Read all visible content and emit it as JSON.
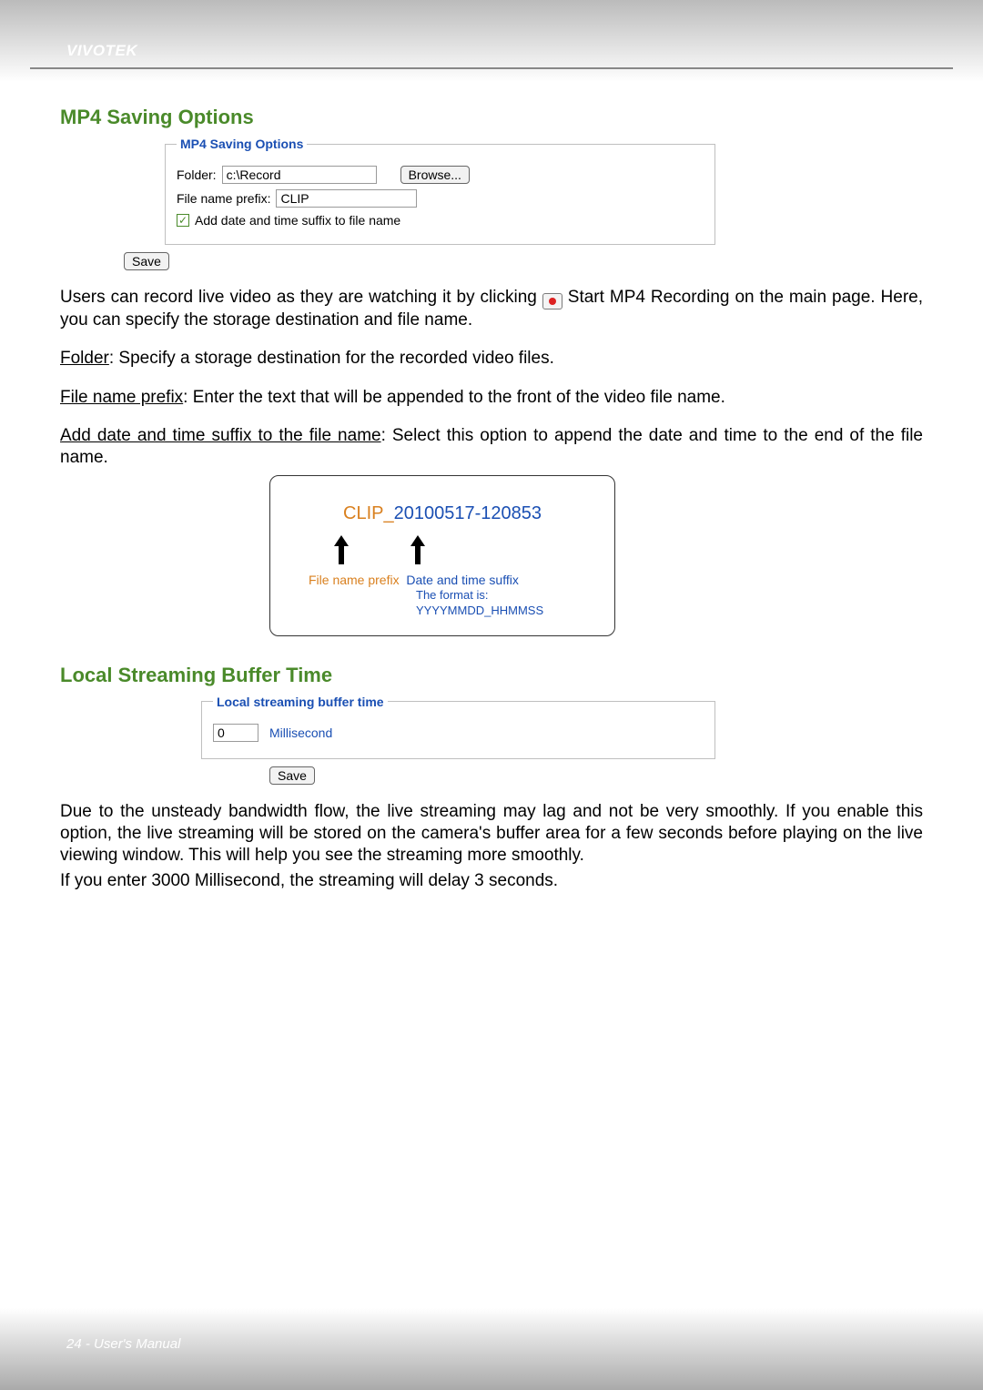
{
  "header": {
    "brand": "VIVOTEK"
  },
  "section1": {
    "title": "MP4 Saving Options",
    "shot": {
      "legend": "MP4 Saving Options",
      "folder_label": "Folder:",
      "folder_value": "c:\\Record",
      "browse_label": "Browse...",
      "prefix_label": "File name prefix:",
      "prefix_value": "CLIP",
      "suffix_checked": true,
      "suffix_label": "Add date and time suffix to file name",
      "save_label": "Save"
    },
    "para1_a": "Users can record live video as they are watching it by clicking ",
    "para1_b": " Start MP4 Recording on the main page. Here, you can specify the storage destination and file name.",
    "para2_u": "Folder",
    "para2_rest": ": Specify a storage destination for the recorded video files.",
    "para3_u": "File name prefix",
    "para3_rest": ": Enter the text that will be appended to the front of the video file name.",
    "para4_u": "Add date and time suffix to the file name",
    "para4_rest": ": Select this option to append the date and time to the end of the file name.",
    "example": {
      "prefix": "CLIP_",
      "suffix": "20100517-120853",
      "label_prefix": "File name prefix",
      "label_suffix": "Date and time suffix",
      "format_line": "The format is: YYYYMMDD_HHMMSS"
    }
  },
  "section2": {
    "title": "Local Streaming Buffer Time",
    "shot": {
      "legend": "Local streaming buffer time",
      "value": "0",
      "unit": "Millisecond",
      "save_label": "Save"
    },
    "para": "Due to the unsteady bandwidth flow, the live streaming may lag and not be very smoothly. If you enable this option, the live streaming will be stored on the camera's buffer area for a few seconds before playing on the live viewing window. This will help you see the streaming more smoothly.",
    "para2": "If you enter 3000 Millisecond, the streaming will delay 3 seconds."
  },
  "footer": {
    "text": "24 - User's Manual"
  }
}
